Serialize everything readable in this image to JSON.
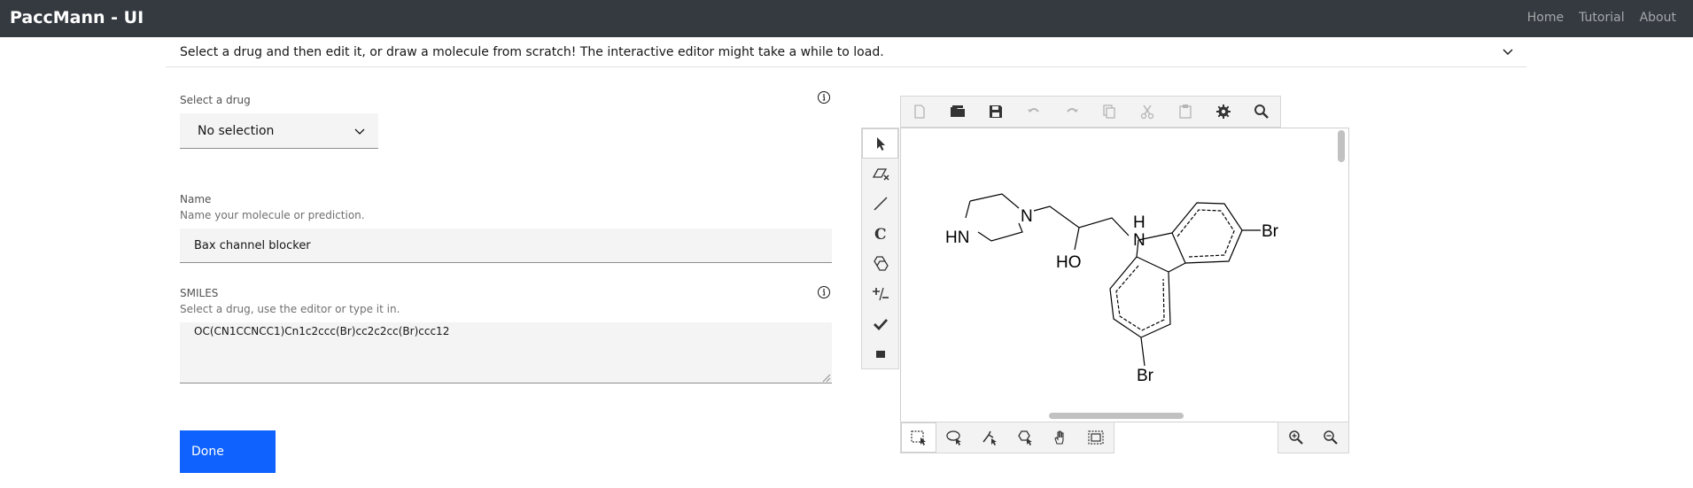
{
  "app": {
    "title": "PaccMann - UI"
  },
  "nav": {
    "items": [
      "Home",
      "Tutorial",
      "About"
    ]
  },
  "banner": {
    "text": "Select a drug and then edit it, or draw a molecule from scratch! The interactive editor might take a while to load."
  },
  "form": {
    "drug_label": "Select a drug",
    "drug_value": "No selection",
    "name_label": "Name",
    "name_helper": "Name your molecule or prediction.",
    "name_value": "Bax channel blocker",
    "smiles_label": "SMILES",
    "smiles_helper": "Select a drug, use the editor or type it in.",
    "smiles_value": "OC(CN1CCNCC1)Cn1c2ccc(Br)cc2c2cc(Br)ccc12",
    "done_label": "Done"
  },
  "editor": {
    "molecule_labels": {
      "hn": "HN",
      "n": "N",
      "ho": "HO",
      "h": "H",
      "n2": "N",
      "br1": "Br",
      "br2": "Br"
    },
    "top_toolbar_icons": [
      "new-icon",
      "open-icon",
      "save-icon",
      "undo-icon",
      "redo-icon",
      "copy-icon",
      "cut-icon",
      "paste-icon",
      "settings-icon",
      "zoom-find-icon"
    ],
    "left_toolbar_icons": [
      "select-arrow-icon",
      "eraser-icon",
      "bond-line-icon",
      "chain-icon",
      "ring-template-icon",
      "charge-icon",
      "check-icon",
      "atom-block-icon"
    ],
    "bottom_toolbar_icons": [
      "rect-select-icon",
      "lasso-icon",
      "fragment-select-icon",
      "ring-select-icon",
      "pan-hand-icon",
      "select-all-icon"
    ],
    "zoom_icons": [
      "zoom-in-icon",
      "zoom-out-icon"
    ]
  }
}
